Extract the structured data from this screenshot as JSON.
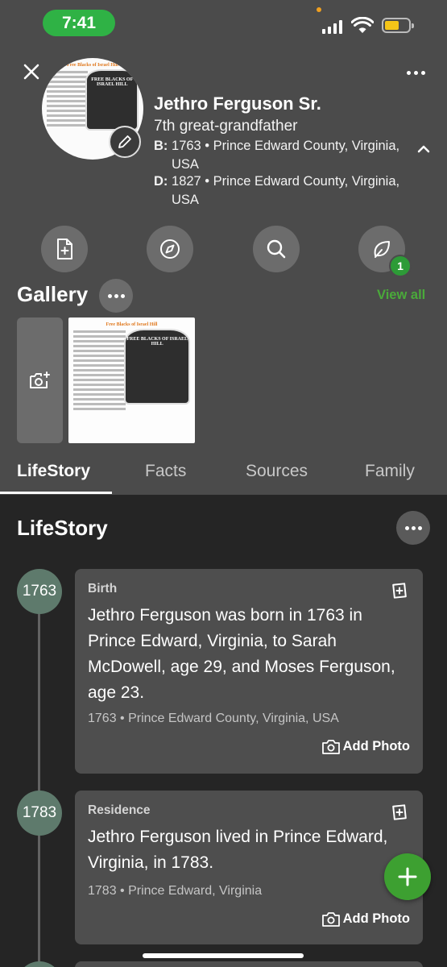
{
  "status_bar": {
    "time": "7:41"
  },
  "profile": {
    "name": "Jethro Ferguson Sr.",
    "relation": "7th great-grandfather",
    "birth_label": "B:",
    "birth_text": "1763 • Prince Edward County, Virginia,",
    "birth_text_2": "USA",
    "death_label": "D:",
    "death_text": "1827 • Prince Edward County, Virginia,",
    "death_text_2": "USA"
  },
  "actions": {
    "badge_count": "1"
  },
  "gallery": {
    "title": "Gallery",
    "view_all": "View all",
    "thumb_title": "Free Blacks of Israel Hill",
    "sign_text": "FREE BLACKS OF ISRAEL HILL"
  },
  "tabs": [
    {
      "label": "LifeStory"
    },
    {
      "label": "Facts"
    },
    {
      "label": "Sources"
    },
    {
      "label": "Family"
    }
  ],
  "lifestory": {
    "title": "LifeStory",
    "events": [
      {
        "year": "1763",
        "type": "Birth",
        "text": "Jethro Ferguson was born in 1763 in Prince Edward, Virginia, to Sarah McDowell, age 29, and Moses Ferguson, age 23.",
        "meta": "1763 • Prince Edward County, Virginia, USA",
        "add_photo": "Add Photo"
      },
      {
        "year": "1783",
        "type": "Residence",
        "text": "Jethro Ferguson lived in Prince Edward, Virginia, in 1783.",
        "meta": "1783 • Prince Edward, Virginia",
        "add_photo": "Add Photo"
      }
    ]
  },
  "colors": {
    "header_bg": "#4b4b4b",
    "body_bg": "#252525",
    "accent_green": "#3da031",
    "time_pill": "#2fb245",
    "year_circle": "#5e7a6c"
  }
}
